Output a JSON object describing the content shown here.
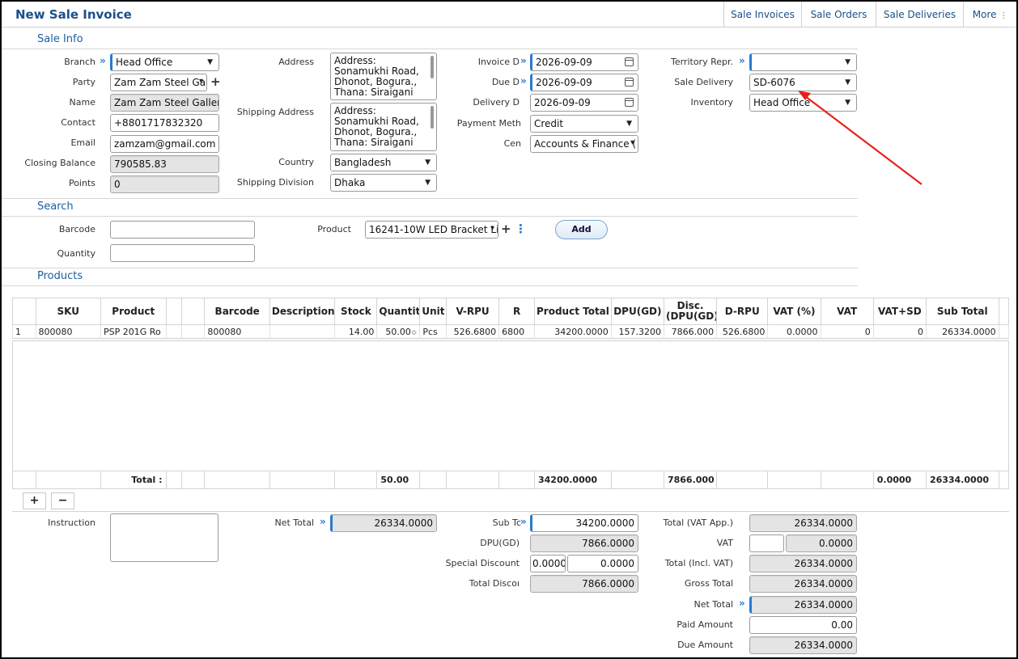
{
  "header": {
    "title": "New Sale Invoice",
    "tabs": [
      "Sale Invoices",
      "Sale Orders",
      "Sale Deliveries",
      "More"
    ]
  },
  "sale_info": {
    "section_title": "Sale Info",
    "branch": {
      "label": "Branch",
      "value": "Head Office"
    },
    "party": {
      "label": "Party",
      "value": "Zam Zam Steel Gal"
    },
    "name": {
      "label": "Name",
      "value": "Zam Zam Steel Gallery"
    },
    "contact": {
      "label": "Contact",
      "value": "+8801717832320"
    },
    "email": {
      "label": "Email",
      "value": "zamzam@gmail.com"
    },
    "closing_balance": {
      "label": "Closing Balance",
      "value": "790585.83"
    },
    "points": {
      "label": "Points",
      "value": "0"
    },
    "address": {
      "label": "Address",
      "value": "Address: Sonamukhi Road, Dhonot, Bogura., Thana: Siraigani"
    },
    "shipping_address": {
      "label": "Shipping Address",
      "value": "Address: Sonamukhi Road, Dhonot, Bogura., Thana: Siraigani"
    },
    "country": {
      "label": "Country",
      "value": "Bangladesh"
    },
    "shipping_division": {
      "label": "Shipping Division",
      "value": "Dhaka"
    },
    "invoice_date": {
      "label": "Invoice D",
      "value": "2026-09-09"
    },
    "due_date": {
      "label": "Due D",
      "value": "2026-09-09"
    },
    "delivery_date": {
      "label": "Delivery D",
      "value": "2026-09-09"
    },
    "payment_method": {
      "label": "Payment Meth",
      "value": "Credit"
    },
    "cen": {
      "label": "Cen",
      "value": "Accounts & Finance ("
    },
    "territory_repr": {
      "label": "Territory Repr.",
      "value": ""
    },
    "sale_delivery": {
      "label": "Sale Delivery",
      "value": "SD-6076"
    },
    "inventory": {
      "label": "Inventory",
      "value": "Head Office"
    }
  },
  "search": {
    "section_title": "Search",
    "barcode_label": "Barcode",
    "quantity_label": "Quantity",
    "product_label": "Product",
    "product_value": "16241-10W LED Bracket Li",
    "add_label": "Add"
  },
  "products": {
    "section_title": "Products",
    "columns": [
      "SKU",
      "Product",
      "",
      "",
      "Barcode",
      "Description",
      "Stock",
      "Quantity",
      "Unit",
      "V-RPU",
      "R",
      "Product Total",
      "DPU(GD)",
      "Disc. (DPU(GD)",
      "D-RPU",
      "VAT (%)",
      "VAT",
      "VAT+SD",
      "Sub Total"
    ],
    "rows": [
      {
        "no": "1",
        "sku": "800080",
        "product": "PSP 201G Ro",
        "barcode": "800080",
        "description": "",
        "stock": "14.00",
        "quantity": "50.00",
        "unit": "Pcs",
        "v_rpu": "526.6800",
        "r": "6800",
        "product_total": "34200.0000",
        "dpu_gd": "157.3200",
        "disc": "7866.000",
        "d_rpu": "526.6800",
        "vat_pct": "0.0000",
        "vat": "0",
        "vat_sd": "0",
        "sub_total": "26334.0000"
      }
    ],
    "totals": {
      "label": "Total :",
      "quantity": "50.00",
      "product_total": "34200.0000",
      "disc": "7866.000",
      "vat_sd": "0.0000",
      "sub_total": "26334.0000"
    }
  },
  "summary": {
    "instruction_label": "Instruction",
    "net_total_label": "Net Total",
    "net_total_value": "26334.0000",
    "sub_total_label": "Sub Tc",
    "sub_total_value": "34200.0000",
    "dpu_gd_label": "DPU(GD)",
    "dpu_gd_value": "7866.0000",
    "special_discount_label": "Special Discount",
    "special_discount_pct": "0.0000",
    "special_discount_value": "0.0000",
    "total_discount_label": "Total Discoı",
    "total_discount_value": "7866.0000",
    "total_vat_app_label": "Total (VAT App.)",
    "total_vat_app_value": "26334.0000",
    "vat_label": "VAT",
    "vat_value": "0.0000",
    "total_incl_vat_label": "Total (Incl. VAT)",
    "total_incl_vat_value": "26334.0000",
    "gross_total_label": "Gross Total",
    "gross_total_value": "26334.0000",
    "net_total2_label": "Net Total",
    "net_total2_value": "26334.0000",
    "paid_amount_label": "Paid Amount",
    "paid_amount_value": "0.00",
    "due_amount_label": "Due Amount",
    "due_amount_value": "26334.0000"
  },
  "colors": {
    "accent": "#2a7ad0",
    "title": "#1b4f8a",
    "arrow": "#e8201a"
  }
}
